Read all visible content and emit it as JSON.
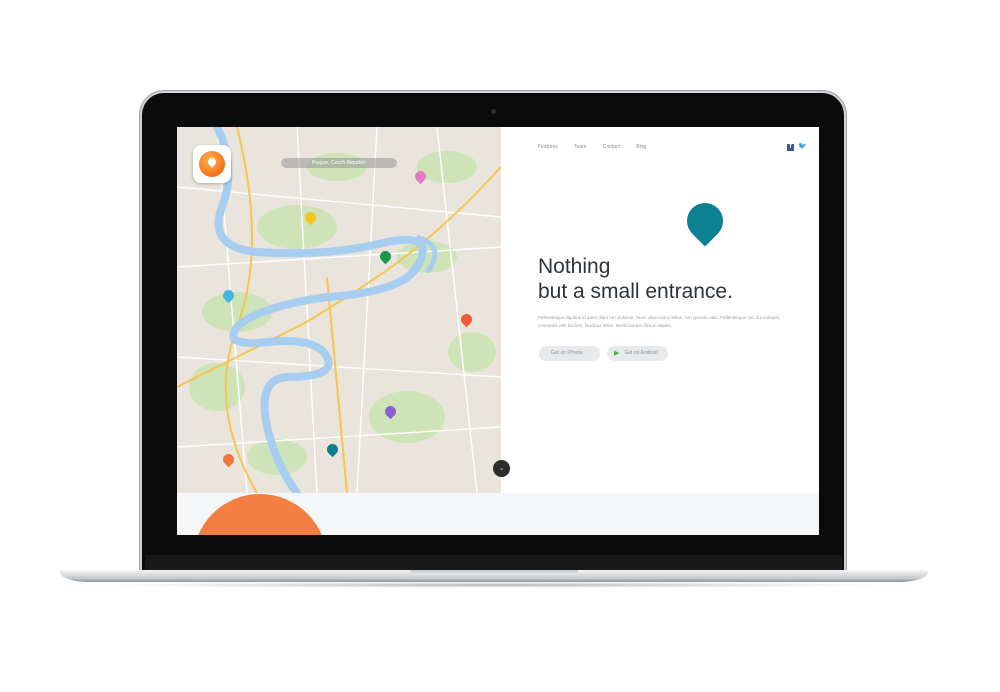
{
  "map": {
    "search_label": "Prague, Czech Republic",
    "pins": [
      {
        "name": "pin-pink",
        "color": "#e27ac6"
      },
      {
        "name": "pin-yellow",
        "color": "#f7c31e"
      },
      {
        "name": "pin-green",
        "color": "#189a4a"
      },
      {
        "name": "pin-light-blue",
        "color": "#41b7e0"
      },
      {
        "name": "pin-red",
        "color": "#ee5a3c"
      },
      {
        "name": "pin-purple",
        "color": "#8c5fce"
      },
      {
        "name": "pin-teal",
        "color": "#0a7f8e"
      },
      {
        "name": "pin-orange",
        "color": "#f3743d"
      }
    ],
    "water_color": "#a7cdf0",
    "park_color": "#cce3b5",
    "road_color": "#f6c453",
    "scroll_icon": "chevron-down-icon"
  },
  "nav": {
    "items": [
      "Features",
      "Team",
      "Contact",
      "Blog"
    ],
    "social": [
      "facebook-icon",
      "twitter-icon"
    ]
  },
  "hero": {
    "accent": "#0c8191",
    "headline_line1": "Nothing",
    "headline_line2": "but a small entrance.",
    "body": "Pellentesque dapibus id amet diam nec pulvinar. Nunc vitae luctus tellus, non gravida odio. Pellentesque nec dui volutpat, venenatis velit facilisis, faucibus tellus. Morbi laoreet dictum sapien.",
    "buttons": [
      {
        "label": "Get on iPhone",
        "icon": "apple-icon"
      },
      {
        "label": "Get on Android",
        "icon": "play-store-icon"
      }
    ]
  },
  "colors": {
    "orange_circle": "#f47f43",
    "lower_band": "#f5f6f8"
  }
}
